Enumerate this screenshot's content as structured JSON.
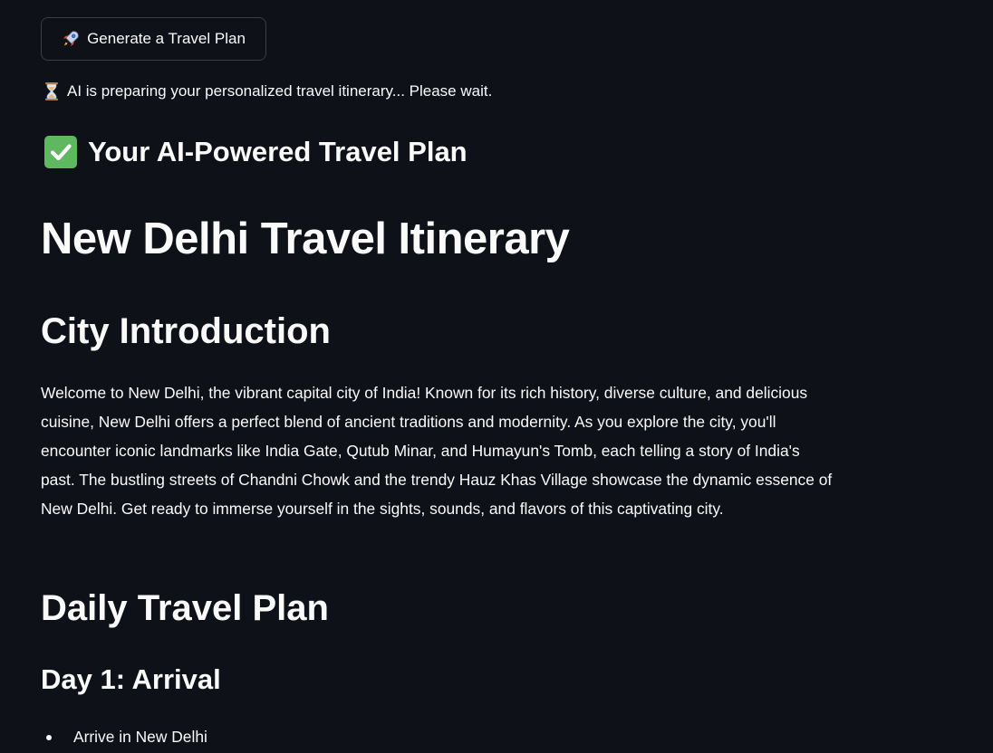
{
  "actions": {
    "generate_button_label": "Generate a Travel Plan"
  },
  "status": {
    "message": "AI is preparing your personalized travel itinerary... Please wait."
  },
  "result": {
    "heading": "Your AI-Powered Travel Plan"
  },
  "itinerary": {
    "title": "New Delhi Travel Itinerary",
    "intro_heading": "City Introduction",
    "intro_text": "Welcome to New Delhi, the vibrant capital city of India! Known for its rich history, diverse culture, and delicious cuisine, New Delhi offers a perfect blend of ancient traditions and modernity. As you explore the city, you'll encounter iconic landmarks like India Gate, Qutub Minar, and Humayun's Tomb, each telling a story of India's past. The bustling streets of Chandni Chowk and the trendy Hauz Khas Village showcase the dynamic essence of New Delhi. Get ready to immerse yourself in the sights, sounds, and flavors of this captivating city.",
    "daily_heading": "Daily Travel Plan",
    "days": [
      {
        "title": "Day 1: Arrival",
        "items": [
          "Arrive in New Delhi"
        ]
      }
    ]
  },
  "icons": {
    "button_icon": "rocket-icon",
    "status_icon": "hourglass-icon",
    "heading_icon": "check-mark-icon"
  },
  "colors": {
    "background": "#0e1117",
    "text": "#fafafa",
    "button_border": "#3a3d46",
    "check_green": "#5fb85f"
  }
}
